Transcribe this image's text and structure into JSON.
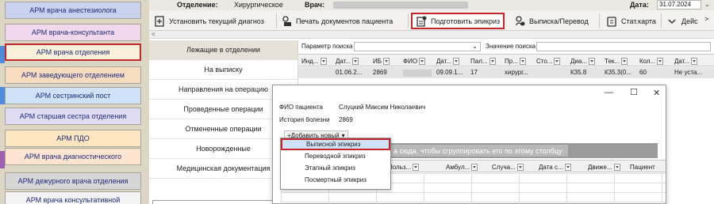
{
  "arm_menu": {
    "items": [
      {
        "label": "АРМ врача анестезиолога",
        "color": "#c9d3f0",
        "name": "arm-anesthesiologist"
      },
      {
        "label": "АРМ врача-консультанта",
        "color": "#f1d8ec",
        "name": "arm-consultant"
      },
      {
        "label": "АРМ врача отделения",
        "color": "#f8f0d8",
        "name": "arm-department-doctor",
        "selected": true
      },
      {
        "label": "АРМ заведующего отделением",
        "color": "#f8dcc0",
        "name": "arm-head-of-department"
      },
      {
        "label": "АРМ сестринский пост",
        "color": "#cfe3f8",
        "name": "arm-nurse-post"
      },
      {
        "label": "АРМ старшая сестра отделения",
        "color": "#e0dcf3",
        "name": "arm-senior-nurse"
      },
      {
        "label": "АРМ ПДО",
        "color": "#fbe6bf",
        "name": "arm-pdo"
      },
      {
        "label": "АРМ врача диагностического",
        "color": "#fde4d0",
        "name": "arm-diagnostic"
      },
      {
        "label": "АРМ дежурного врача отделения",
        "color": "#d6d6d6",
        "name": "arm-duty-doctor"
      },
      {
        "label": "АРМ врача консультативной",
        "color": "#f3f3f3",
        "name": "arm-consultative"
      }
    ]
  },
  "info_bar": {
    "department_label": "Отделение:",
    "department_value": "Хирургическое",
    "doctor_label": "Врач:",
    "date_label": "Дата:",
    "date_value": "31.07.2024"
  },
  "toolbar": {
    "set_diagnosis": "Установить текущий диагноз",
    "print_docs": "Печать документов пациента",
    "prepare_epicrisis": "Подготовить эпикриз",
    "discharge": "Выписка/Перевод",
    "stat_card": "Стат.карта",
    "actions": "Дейс"
  },
  "nav": {
    "items": [
      {
        "label": "Лежащие в отделении",
        "active": true
      },
      {
        "label": "На выписку"
      },
      {
        "label": "Направления на операцию"
      },
      {
        "label": "Проведенные операции"
      },
      {
        "label": "Отмененные операции"
      },
      {
        "label": "Новорожденные"
      },
      {
        "label": "Медицинская документация"
      }
    ]
  },
  "search": {
    "param_label": "Параметр поиска",
    "value_label": "Значение поиска"
  },
  "grid": {
    "columns": [
      "Инд...",
      "Дат...",
      "ИБ",
      "ФИО",
      "Дат...",
      "Пал...",
      "Пр...",
      "Сто...",
      "Диа...",
      "Тек...",
      "Кол...",
      "Дат..."
    ],
    "row": [
      "01.06.2...",
      "2869",
      "",
      "09.09.1...",
      "17",
      "хирург...",
      "",
      "К35.8",
      "К35.3(0...",
      "60",
      "Не уста..."
    ]
  },
  "popup": {
    "patient_label": "ФИО пациента",
    "patient_name": "Слуцкий Максим Николаевич",
    "history_label": "История болезни",
    "history_value": "2869",
    "add_new": "+Добавить новый",
    "group_hint": "а сюда, чтобы сгруппировать его по этому столбцу",
    "columns": [
      "Польз...",
      "Амбул...",
      "Случа...",
      "Дата с...",
      "Движе...",
      "Пациент"
    ]
  },
  "add_menu": {
    "items": [
      "Выписной эпикриз",
      "Переводной эпикриз",
      "Этапный эпикриз",
      "Посмертный эпикриз"
    ]
  }
}
